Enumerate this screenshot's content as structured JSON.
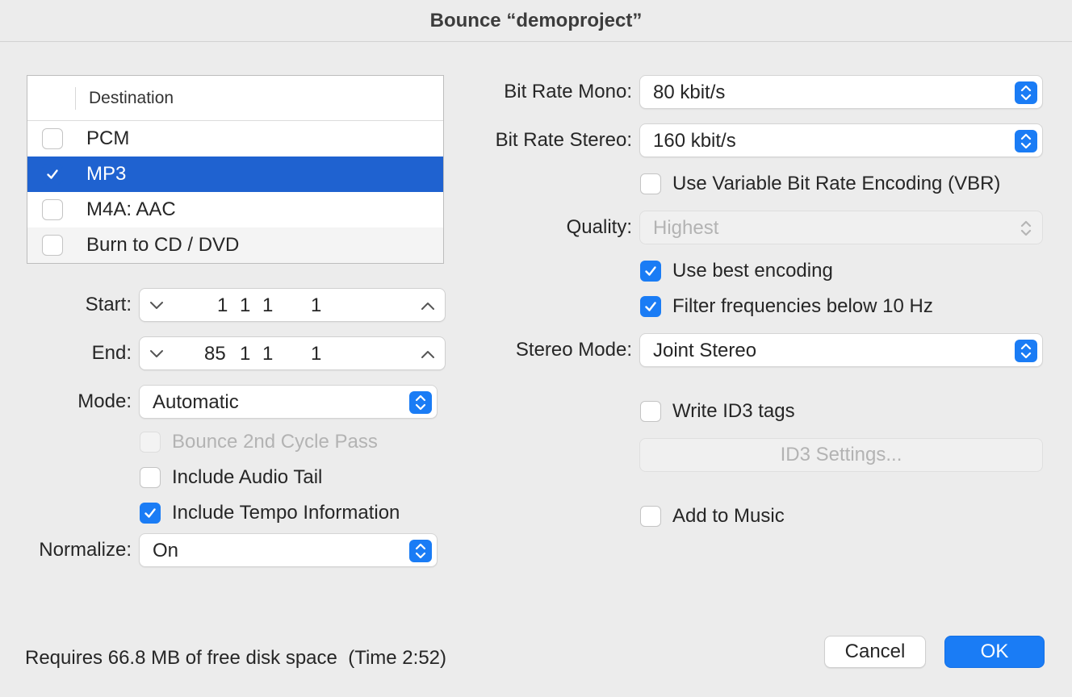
{
  "window": {
    "title": "Bounce “demoproject”"
  },
  "destination": {
    "header": "Destination",
    "rows": [
      {
        "label": "PCM",
        "checked": false,
        "selected": false
      },
      {
        "label": "MP3",
        "checked": true,
        "selected": true
      },
      {
        "label": "M4A: AAC",
        "checked": false,
        "selected": false
      },
      {
        "label": "Burn to CD / DVD",
        "checked": false,
        "selected": false
      }
    ]
  },
  "start": {
    "label": "Start:",
    "bar": "1",
    "beat": "1",
    "div": "1",
    "tick": "1"
  },
  "end": {
    "label": "End:",
    "bar": "85",
    "beat": "1",
    "div": "1",
    "tick": "1"
  },
  "mode": {
    "label": "Mode:",
    "value": "Automatic"
  },
  "bounce_2nd_cycle": {
    "label": "Bounce 2nd Cycle Pass",
    "checked": false,
    "enabled": false
  },
  "include_audio_tail": {
    "label": "Include Audio Tail",
    "checked": false
  },
  "include_tempo": {
    "label": "Include Tempo Information",
    "checked": true
  },
  "normalize": {
    "label": "Normalize:",
    "value": "On"
  },
  "bit_rate_mono": {
    "label": "Bit Rate Mono:",
    "value": "80 kbit/s"
  },
  "bit_rate_stereo": {
    "label": "Bit Rate Stereo:",
    "value": "160 kbit/s"
  },
  "vbr": {
    "label": "Use Variable Bit Rate Encoding (VBR)",
    "checked": false
  },
  "quality": {
    "label": "Quality:",
    "value": "Highest",
    "enabled": false
  },
  "best_encoding": {
    "label": "Use best encoding",
    "checked": true
  },
  "filter_freq": {
    "label": "Filter frequencies below 10 Hz",
    "checked": true
  },
  "stereo_mode": {
    "label": "Stereo Mode:",
    "value": "Joint Stereo"
  },
  "write_id3": {
    "label": "Write ID3 tags",
    "checked": false
  },
  "id3_settings": {
    "label": "ID3 Settings..."
  },
  "add_to_music": {
    "label": "Add to Music",
    "checked": false
  },
  "footer": {
    "status": "Requires 66.8 MB of free disk space  (Time 2:52)"
  },
  "buttons": {
    "cancel": "Cancel",
    "ok": "OK"
  },
  "colors": {
    "accent": "#1a7cf5",
    "selection": "#1f62d0",
    "background": "#ececec"
  }
}
